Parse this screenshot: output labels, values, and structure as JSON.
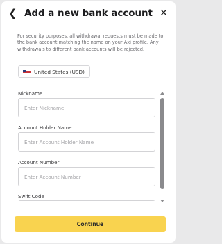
{
  "modal": {
    "title": "Add a new bank account",
    "back_icon": "chevron-left-icon",
    "close_icon": "close-icon",
    "notice": "For security purposes, all withdrawal requests must be made to the bank account matching the name on your Axi profile. Any withdrawals to different bank accounts will be rejected."
  },
  "currency": {
    "flag": "us-flag-icon",
    "label": "United States (USD)"
  },
  "form": {
    "nickname": {
      "label": "Nickname",
      "placeholder": "Enter Nickname",
      "value": ""
    },
    "holder": {
      "label": "Account Holder Name",
      "placeholder": "Enter Account Holder Name",
      "value": ""
    },
    "number": {
      "label": "Account Number",
      "placeholder": "Enter Account Number",
      "value": ""
    },
    "swift": {
      "label": "Swift Code",
      "placeholder": "",
      "value": ""
    }
  },
  "actions": {
    "continue_label": "Continue",
    "accent": "#f9d34f"
  }
}
